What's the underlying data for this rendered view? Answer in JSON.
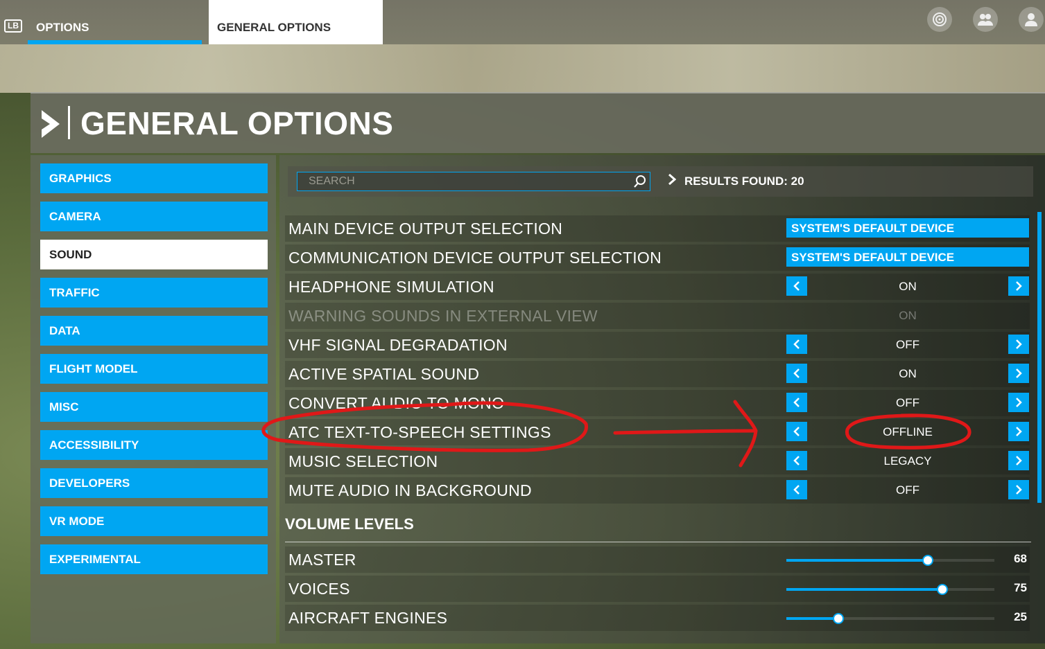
{
  "topbar": {
    "fps_text": "",
    "lb_badge": "LB",
    "tabs": [
      "OPTIONS",
      "GENERAL OPTIONS"
    ],
    "icons": [
      "dev-mode-icon",
      "multiplayer-icon",
      "profile-icon"
    ]
  },
  "header": {
    "title": "GENERAL OPTIONS"
  },
  "sidebar": {
    "items": [
      {
        "label": "GRAPHICS",
        "active": false
      },
      {
        "label": "CAMERA",
        "active": false
      },
      {
        "label": "SOUND",
        "active": true
      },
      {
        "label": "TRAFFIC",
        "active": false
      },
      {
        "label": "DATA",
        "active": false
      },
      {
        "label": "FLIGHT MODEL",
        "active": false
      },
      {
        "label": "MISC",
        "active": false
      },
      {
        "label": "ACCESSIBILITY",
        "active": false
      },
      {
        "label": "DEVELOPERS",
        "active": false
      },
      {
        "label": "VR MODE",
        "active": false
      },
      {
        "label": "EXPERIMENTAL",
        "active": false
      }
    ]
  },
  "search": {
    "placeholder": "SEARCH",
    "results_text": "RESULTS FOUND: 20"
  },
  "settings": [
    {
      "label": "MAIN DEVICE OUTPUT SELECTION",
      "type": "dropdown",
      "value": "SYSTEM'S DEFAULT DEVICE"
    },
    {
      "label": "COMMUNICATION DEVICE OUTPUT SELECTION",
      "type": "dropdown",
      "value": "SYSTEM'S DEFAULT DEVICE"
    },
    {
      "label": "HEADPHONE SIMULATION",
      "type": "toggle",
      "value": "ON"
    },
    {
      "label": "WARNING SOUNDS IN EXTERNAL VIEW",
      "type": "toggle",
      "value": "ON",
      "disabled": true
    },
    {
      "label": "VHF SIGNAL DEGRADATION",
      "type": "toggle",
      "value": "OFF"
    },
    {
      "label": "ACTIVE SPATIAL SOUND",
      "type": "toggle",
      "value": "ON"
    },
    {
      "label": "CONVERT AUDIO TO MONO",
      "type": "toggle",
      "value": "OFF"
    },
    {
      "label": "ATC TEXT-TO-SPEECH SETTINGS",
      "type": "toggle",
      "value": "OFFLINE"
    },
    {
      "label": "MUSIC SELECTION",
      "type": "toggle",
      "value": "LEGACY"
    },
    {
      "label": "MUTE AUDIO IN BACKGROUND",
      "type": "toggle",
      "value": "OFF"
    }
  ],
  "volume": {
    "title": "VOLUME LEVELS",
    "sliders": [
      {
        "label": "MASTER",
        "value": "68",
        "fraction": 0.68
      },
      {
        "label": "VOICES",
        "value": "75",
        "fraction": 0.75
      },
      {
        "label": "AIRCRAFT ENGINES",
        "value": "25",
        "fraction": 0.25
      }
    ]
  },
  "colors": {
    "accent": "#00a6f2",
    "annotation": "#e01818"
  }
}
